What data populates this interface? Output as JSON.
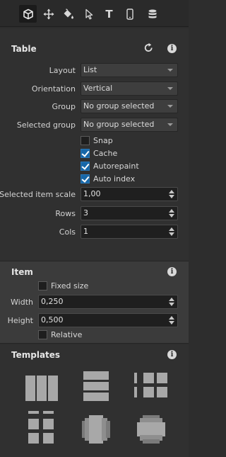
{
  "toolbar": {
    "tools": [
      {
        "icon": "cube-icon",
        "active": true
      },
      {
        "icon": "move-icon",
        "active": false
      },
      {
        "icon": "paint-bucket-icon",
        "active": false
      },
      {
        "icon": "pointer-icon",
        "active": false
      },
      {
        "icon": "text-icon",
        "active": false
      },
      {
        "icon": "phone-icon",
        "active": false
      },
      {
        "icon": "database-icon",
        "active": false
      }
    ],
    "tool_glyph_text": "T"
  },
  "table": {
    "title": "Table",
    "layout_label": "Layout",
    "layout_value": "List",
    "orientation_label": "Orientation",
    "orientation_value": "Vertical",
    "group_label": "Group",
    "group_value": "No group selected",
    "selected_group_label": "Selected group",
    "selected_group_value": "No group selected",
    "snap_label": "Snap",
    "snap_checked": false,
    "cache_label": "Cache",
    "cache_checked": true,
    "autorepaint_label": "Autorepaint",
    "autorepaint_checked": true,
    "autoindex_label": "Auto index",
    "autoindex_checked": true,
    "item_scale_label": "Selected item scale",
    "item_scale_value": "1,00",
    "rows_label": "Rows",
    "rows_value": "3",
    "cols_label": "Cols",
    "cols_value": "1"
  },
  "item": {
    "title": "Item",
    "fixed_size_label": "Fixed size",
    "fixed_size_checked": false,
    "width_label": "Width",
    "width_value": "0,250",
    "height_label": "Height",
    "height_value": "0,500",
    "relative_label": "Relative",
    "relative_checked": false
  },
  "templates": {
    "title": "Templates",
    "items": [
      "three-columns-template",
      "three-rows-template",
      "two-by-three-grid-template",
      "three-by-two-grid-template",
      "horizontal-stack-template",
      "vertical-stack-template"
    ]
  },
  "info_glyph": "i",
  "colors": {
    "accent": "#1767a8",
    "panel": "#303030",
    "item_panel": "#3b3b3b",
    "template_fill": "#a8a8a8"
  }
}
